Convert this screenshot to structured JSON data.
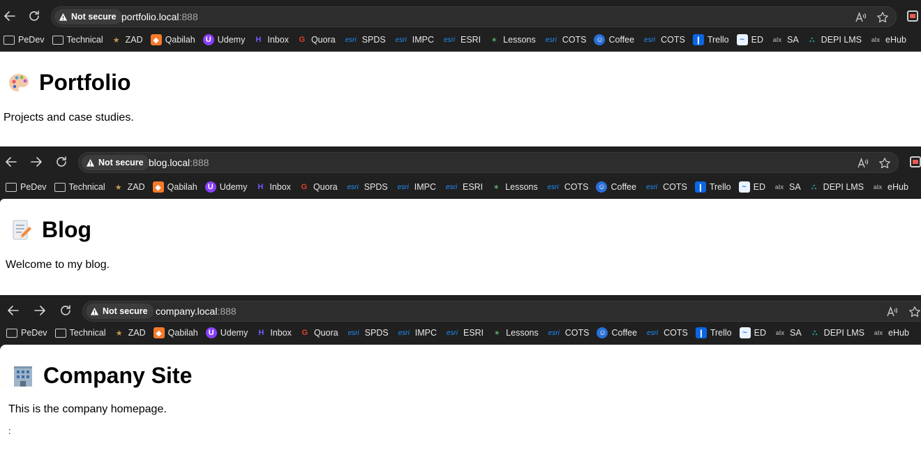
{
  "bookmarks": [
    {
      "label": "PeDev",
      "icon": "folder-icon"
    },
    {
      "label": "Technical",
      "icon": "folder-icon"
    },
    {
      "label": "ZAD",
      "icon": "zad-icon"
    },
    {
      "label": "Qabilah",
      "icon": "qabilah-icon"
    },
    {
      "label": "Udemy",
      "icon": "udemy-icon"
    },
    {
      "label": "Inbox",
      "icon": "inbox-icon"
    },
    {
      "label": "Quora",
      "icon": "quora-icon"
    },
    {
      "label": "SPDS",
      "icon": "esri-icon"
    },
    {
      "label": "IMPC",
      "icon": "esri-icon"
    },
    {
      "label": "ESRI",
      "icon": "esri-icon"
    },
    {
      "label": "Lessons",
      "icon": "lessons-icon"
    },
    {
      "label": "COTS",
      "icon": "esri-icon"
    },
    {
      "label": "Coffee",
      "icon": "coffee-icon"
    },
    {
      "label": "COTS",
      "icon": "esri-icon"
    },
    {
      "label": "Trello",
      "icon": "trello-icon"
    },
    {
      "label": "ED",
      "icon": "ed-icon"
    },
    {
      "label": "SA",
      "icon": "alx-icon"
    },
    {
      "label": "DEPI LMS",
      "icon": "depi-icon"
    },
    {
      "label": "eHub",
      "icon": "alx-icon"
    }
  ],
  "esri_text": "esri",
  "alx_text": "alx",
  "security_label": "Not secure",
  "windows": [
    {
      "url_host": "portfolio.local",
      "url_port": ":888",
      "heading": "Portfolio",
      "paragraph": "Projects and case studies.",
      "emoji": "palette-icon"
    },
    {
      "url_host": "blog.local",
      "url_port": ":888",
      "heading": "Blog",
      "paragraph": "Welcome to my blog.",
      "emoji": "memo-icon"
    },
    {
      "url_host": "company.local",
      "url_port": ":888",
      "heading": "Company Site",
      "paragraph": "This is the company homepage.",
      "extra": ":",
      "emoji": "office-building-icon"
    }
  ]
}
